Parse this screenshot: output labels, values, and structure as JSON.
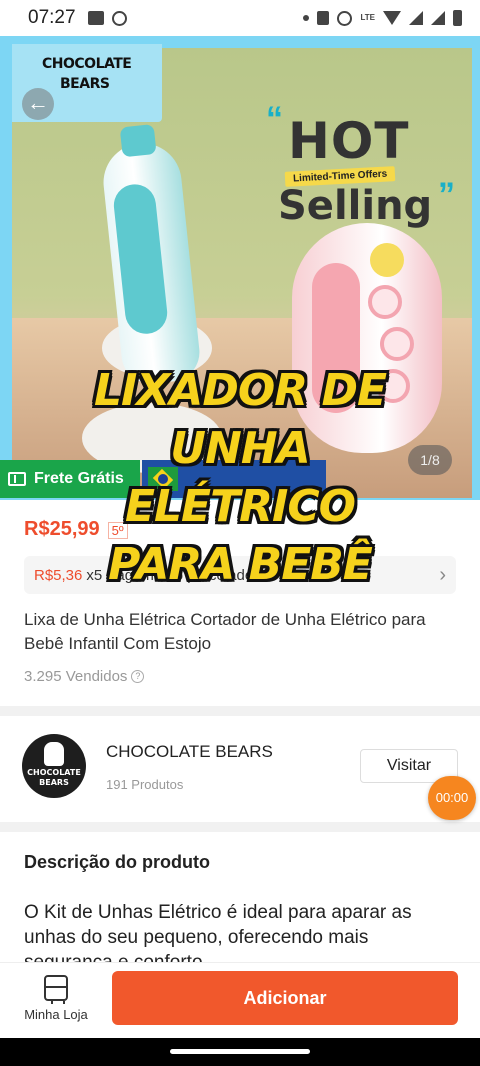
{
  "status_bar": {
    "time": "07:27",
    "network": "LTE"
  },
  "image": {
    "brand_line1": "CHOCOLATE",
    "brand_line2": "BEARS",
    "hot": "HOT",
    "limited": "Limited-Time Offers",
    "selling": "Selling",
    "counter": "1/8",
    "frete": "Frete Grátis"
  },
  "caption": {
    "line1": "LIXADOR DE",
    "line2": "UNHA",
    "line3": "ELÉTRICO",
    "line4": "PARA BEBÊ"
  },
  "product": {
    "price": "R$25,99",
    "discount": "5º",
    "installment_value": "R$5,36",
    "installment_text": "x5 Pagamento parcelado",
    "title": "Lixa de Unha Elétrica Cortador de Unha Elétrico para Bebê Infantil Com Estojo",
    "sold": "3.295 Vendidos"
  },
  "store": {
    "avatar_line1": "CHOCOLATE",
    "avatar_line2": "BEARS",
    "name": "CHOCOLATE BEARS",
    "products": "191 Produtos",
    "visit_label": "Visitar"
  },
  "timer": "00:00",
  "description": {
    "title": "Descrição do produto",
    "text": "O Kit de Unhas Elétrico é ideal para aparar as unhas do seu pequeno, oferecendo mais segurança e conforto"
  },
  "bottom": {
    "shop_label": "Minha Loja",
    "add_label": "Adicionar"
  },
  "colors": {
    "accent": "#ee4d2d",
    "button": "#f1582c",
    "free_shipping": "#1aa54a"
  }
}
